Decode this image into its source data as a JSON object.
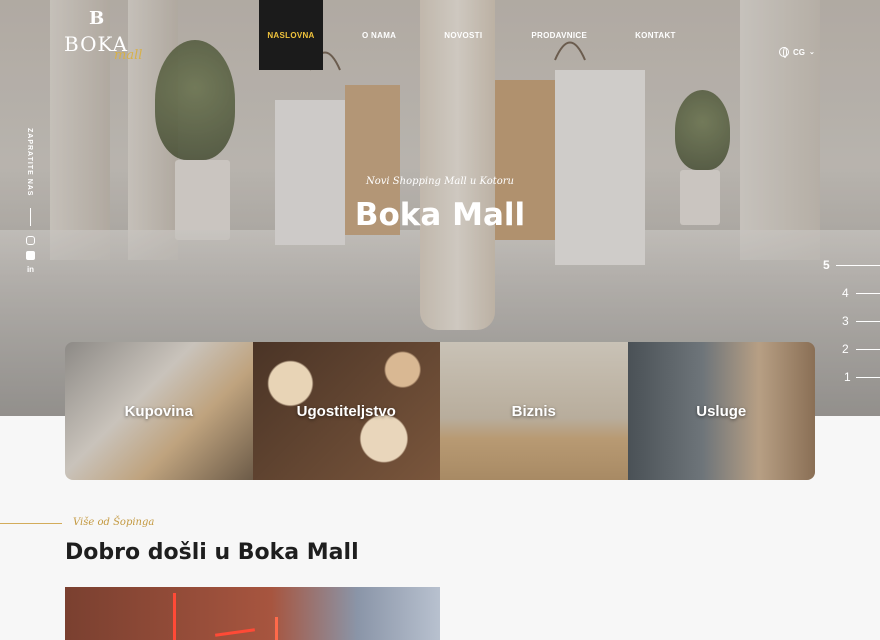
{
  "header": {
    "logo": {
      "mark": "B",
      "name": "BOKA",
      "sub": "mall"
    },
    "nav": [
      {
        "label": "NASLOVNA",
        "active": true
      },
      {
        "label": "O NAMA"
      },
      {
        "label": "NOVOSTI"
      },
      {
        "label": "PRODAVNICE"
      },
      {
        "label": "KONTAKT"
      }
    ],
    "language": {
      "icon": "globe-icon",
      "code": "CG"
    }
  },
  "social": {
    "label": "ZAPRATITE NAS",
    "items": [
      {
        "icon": "instagram-icon"
      },
      {
        "icon": "facebook-icon"
      },
      {
        "icon": "linkedin-icon",
        "text": "in"
      }
    ]
  },
  "hero": {
    "subtitle": "Novi Shopping Mall u Kotoru",
    "title": "Boka Mall",
    "slides": [
      "5",
      "4",
      "3",
      "2",
      "1"
    ],
    "active_slide": "5"
  },
  "categories": [
    {
      "label": "Kupovina"
    },
    {
      "label": "Ugostiteljstvo"
    },
    {
      "label": "Biznis"
    },
    {
      "label": "Usluge"
    }
  ],
  "welcome": {
    "kicker": "Više od Šopinga",
    "title": "Dobro došli u Boka Mall"
  },
  "colors": {
    "accent": "#f0c33c",
    "gold": "#c49a42",
    "dark": "#1b1b1b"
  }
}
